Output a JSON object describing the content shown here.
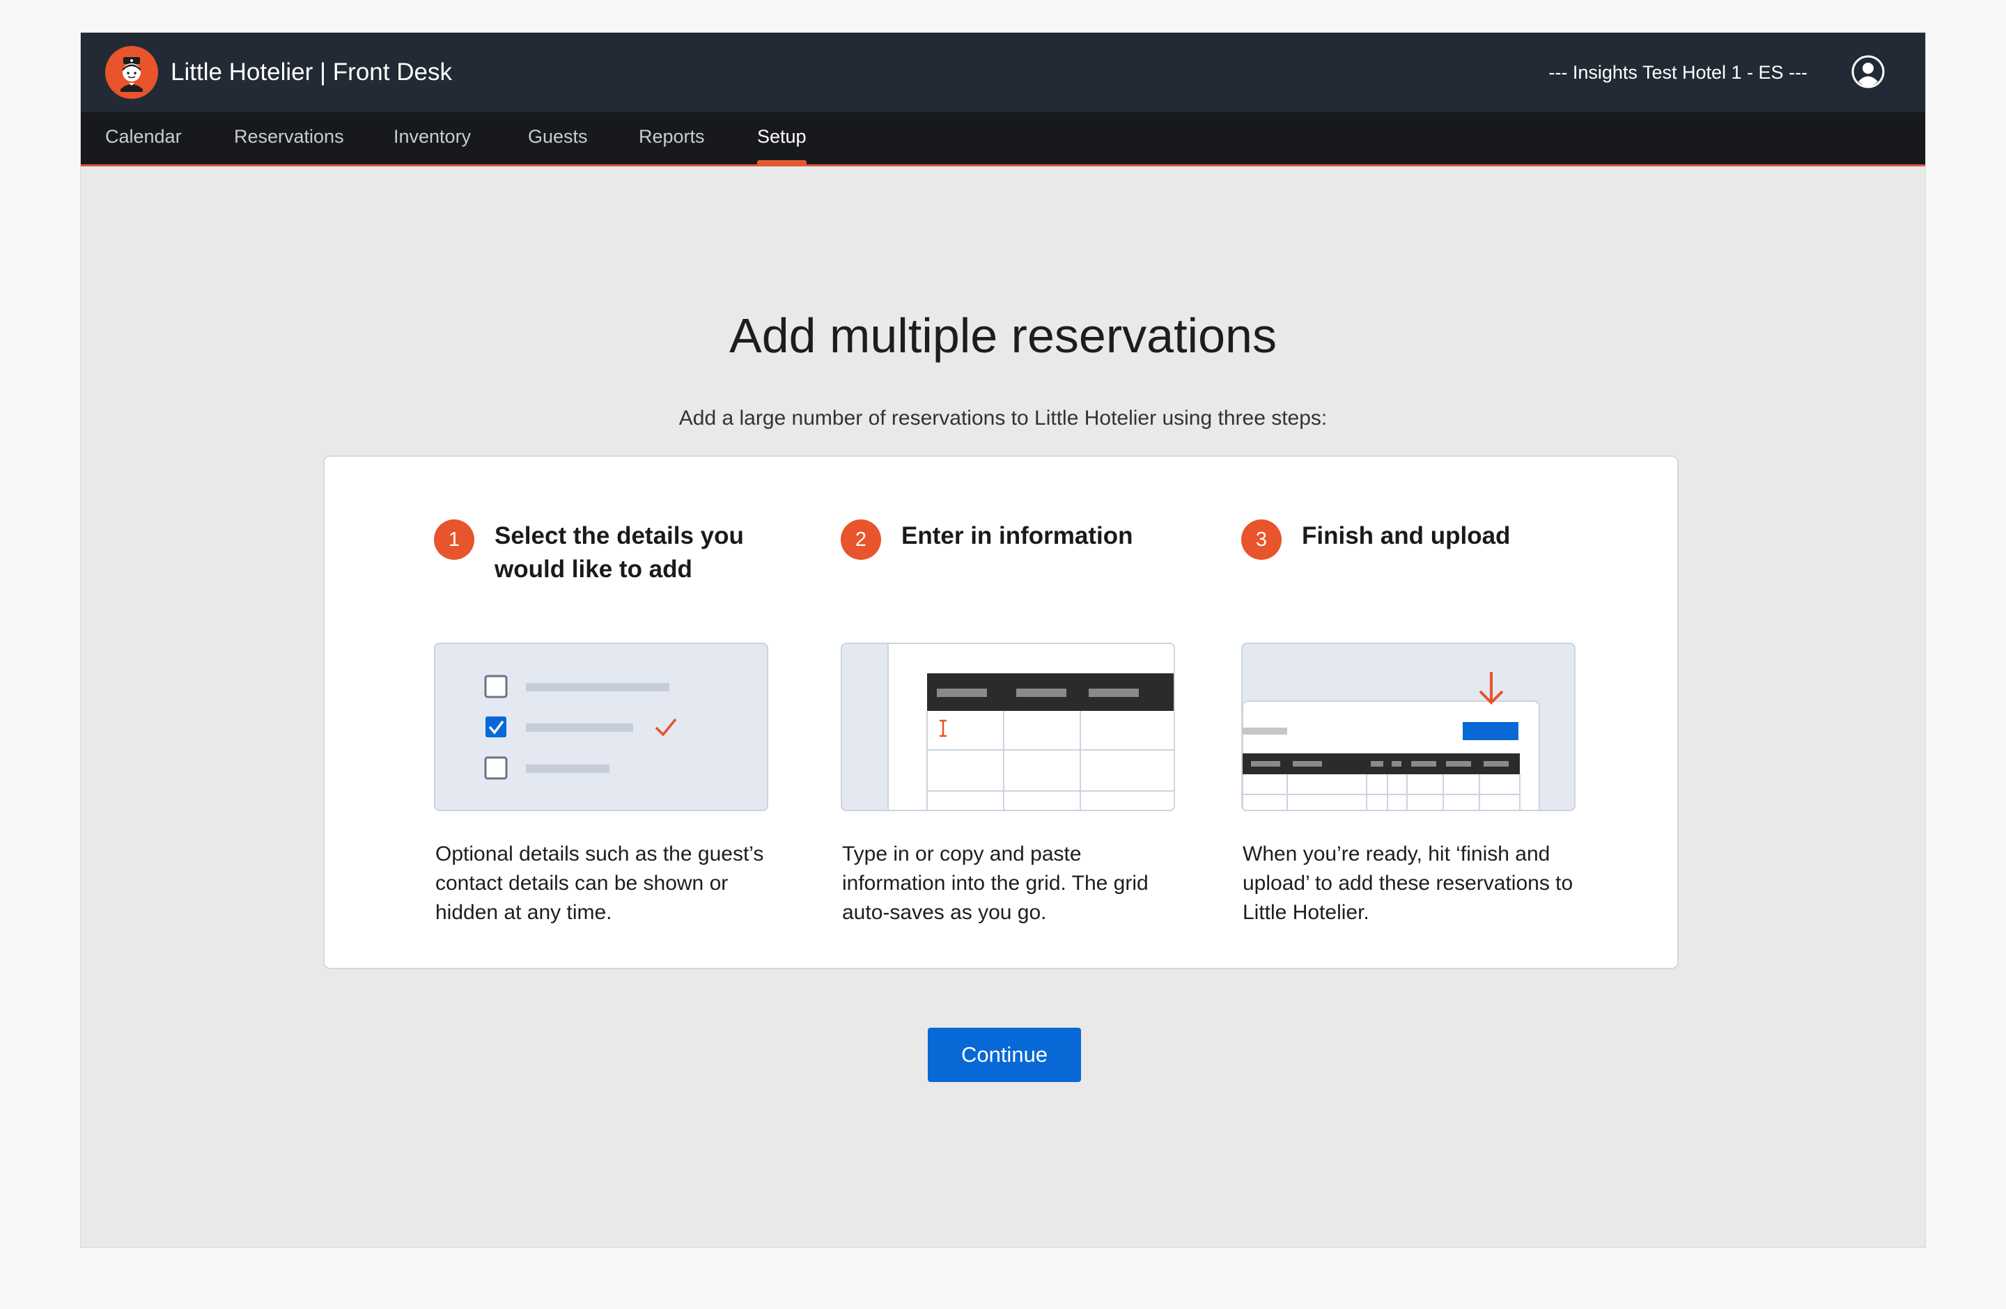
{
  "header": {
    "app_title": "Little Hotelier | Front Desk",
    "hotel_name": "--- Insights Test Hotel 1 - ES ---",
    "logo_icon": "bellhop-logo-icon",
    "user_icon": "user-account-icon",
    "bg_color": "#222a35"
  },
  "nav": {
    "items": [
      {
        "label": "Calendar"
      },
      {
        "label": "Reservations"
      },
      {
        "label": "Inventory"
      },
      {
        "label": "Guests"
      },
      {
        "label": "Reports"
      },
      {
        "label": "Setup",
        "active": true
      }
    ],
    "accent_color": "#e05a33"
  },
  "main": {
    "heading": "Add multiple reservations",
    "subheading": "Add a large number of reservations to Little Hotelier using three steps:",
    "steps": [
      {
        "number": "1",
        "title": "Select the details you would like to add",
        "description": "Optional details such as the guest’s contact details can be shown or hidden at any time.",
        "illustration": "checklist-illustration"
      },
      {
        "number": "2",
        "title": "Enter in information",
        "description": "Type in or copy and paste information into the grid. The grid auto-saves as you go.",
        "illustration": "grid-entry-illustration"
      },
      {
        "number": "3",
        "title": "Finish and upload",
        "description": "When you’re ready, hit ‘finish and upload’ to add these reservations to Little Hotelier.",
        "illustration": "upload-illustration"
      }
    ],
    "continue_label": "Continue",
    "button_color": "#0869d6",
    "step_number_color": "#e8542b"
  }
}
